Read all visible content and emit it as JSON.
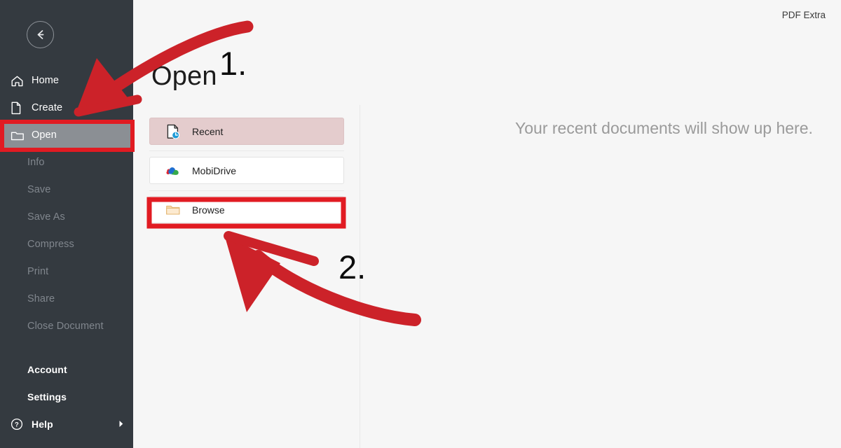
{
  "app": {
    "name": "PDF Extra",
    "brand_dark": "#343a40",
    "accent_red": "#d32229",
    "selected_row_bg": "#e4cccd",
    "active_nav_bg": "#8b8f94"
  },
  "sidebar": {
    "back_button": {
      "name": "back-arrow",
      "label": "Back"
    },
    "items": [
      {
        "label": "Home",
        "icon": "home-icon",
        "state": "normal",
        "has_icon": true
      },
      {
        "label": "Create",
        "icon": "file-plus-icon",
        "state": "normal",
        "has_icon": true
      },
      {
        "label": "Open",
        "icon": "folder-icon",
        "state": "active",
        "has_icon": true
      },
      {
        "label": "Info",
        "icon": "",
        "state": "disabled",
        "has_icon": false
      },
      {
        "label": "Save",
        "icon": "",
        "state": "disabled",
        "has_icon": false
      },
      {
        "label": "Save As",
        "icon": "",
        "state": "disabled",
        "has_icon": false
      },
      {
        "label": "Compress",
        "icon": "",
        "state": "disabled",
        "has_icon": false
      },
      {
        "label": "Print",
        "icon": "",
        "state": "disabled",
        "has_icon": false
      },
      {
        "label": "Share",
        "icon": "",
        "state": "disabled",
        "has_icon": false
      },
      {
        "label": "Close Document",
        "icon": "",
        "state": "disabled",
        "has_icon": false
      }
    ],
    "bottom_items": [
      {
        "label": "Account",
        "icon": "",
        "has_icon": false,
        "has_chevron": false
      },
      {
        "label": "Settings",
        "icon": "",
        "has_icon": false,
        "has_chevron": false
      },
      {
        "label": "Help",
        "icon": "help-circle-icon",
        "has_icon": true,
        "has_chevron": true
      }
    ]
  },
  "main": {
    "title": "Open",
    "empty_state": "Your recent documents will show up here.",
    "sources": [
      {
        "label": "Recent",
        "icon": "recent-document-icon",
        "selected": true
      },
      {
        "label": "MobiDrive",
        "icon": "mobidrive-cloud-icon",
        "selected": false
      },
      {
        "label": "Browse",
        "icon": "folder-icon",
        "selected": false
      }
    ]
  },
  "annotations": {
    "step_one": "1.",
    "step_two": "2.",
    "highlight_color": "#e11b22",
    "arrow_color": "#cc2229",
    "highlighted_targets": [
      "Open",
      "Browse"
    ]
  }
}
